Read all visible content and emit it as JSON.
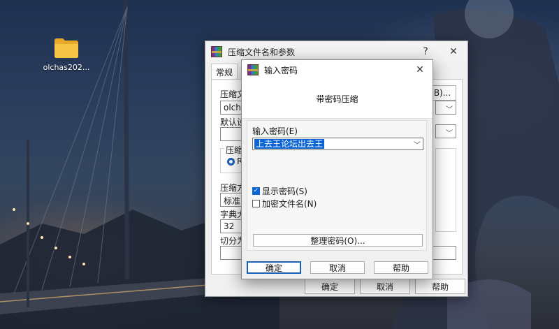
{
  "desktop": {
    "folder_label": "olchas202..."
  },
  "background_dialog": {
    "title": "压缩文件名和参数",
    "help_glyph": "?",
    "close_glyph": "✕",
    "tab_general": "常规",
    "archive_name_label": "压缩文",
    "archive_name_value": "olchas2",
    "browse_fragment": "B)...",
    "default_profile_label": "默认设",
    "group_label": "压缩",
    "radio_fragment": "R",
    "method_label": "压缩方",
    "method_value": "标准",
    "dict_label": "字典大",
    "dict_value": "32",
    "split_label": "切分为",
    "ok_label": "确定",
    "cancel_label": "取消",
    "help_label": "帮助"
  },
  "password_dialog": {
    "title": "输入密码",
    "close_glyph": "✕",
    "header": "带密码压缩",
    "password_label": "输入密码(E)",
    "password_value": "上去王论坛出去王",
    "show_password_label": "显示密码(S)",
    "show_password_checked": true,
    "encrypt_filenames_label": "加密文件名(N)",
    "encrypt_filenames_checked": false,
    "organize_button": "整理密码(O)...",
    "ok_button": "确定",
    "cancel_button": "取消",
    "help_button": "帮助"
  },
  "colors": {
    "accent": "#0a64d6",
    "dialog_bg": "#f0f0f0"
  }
}
